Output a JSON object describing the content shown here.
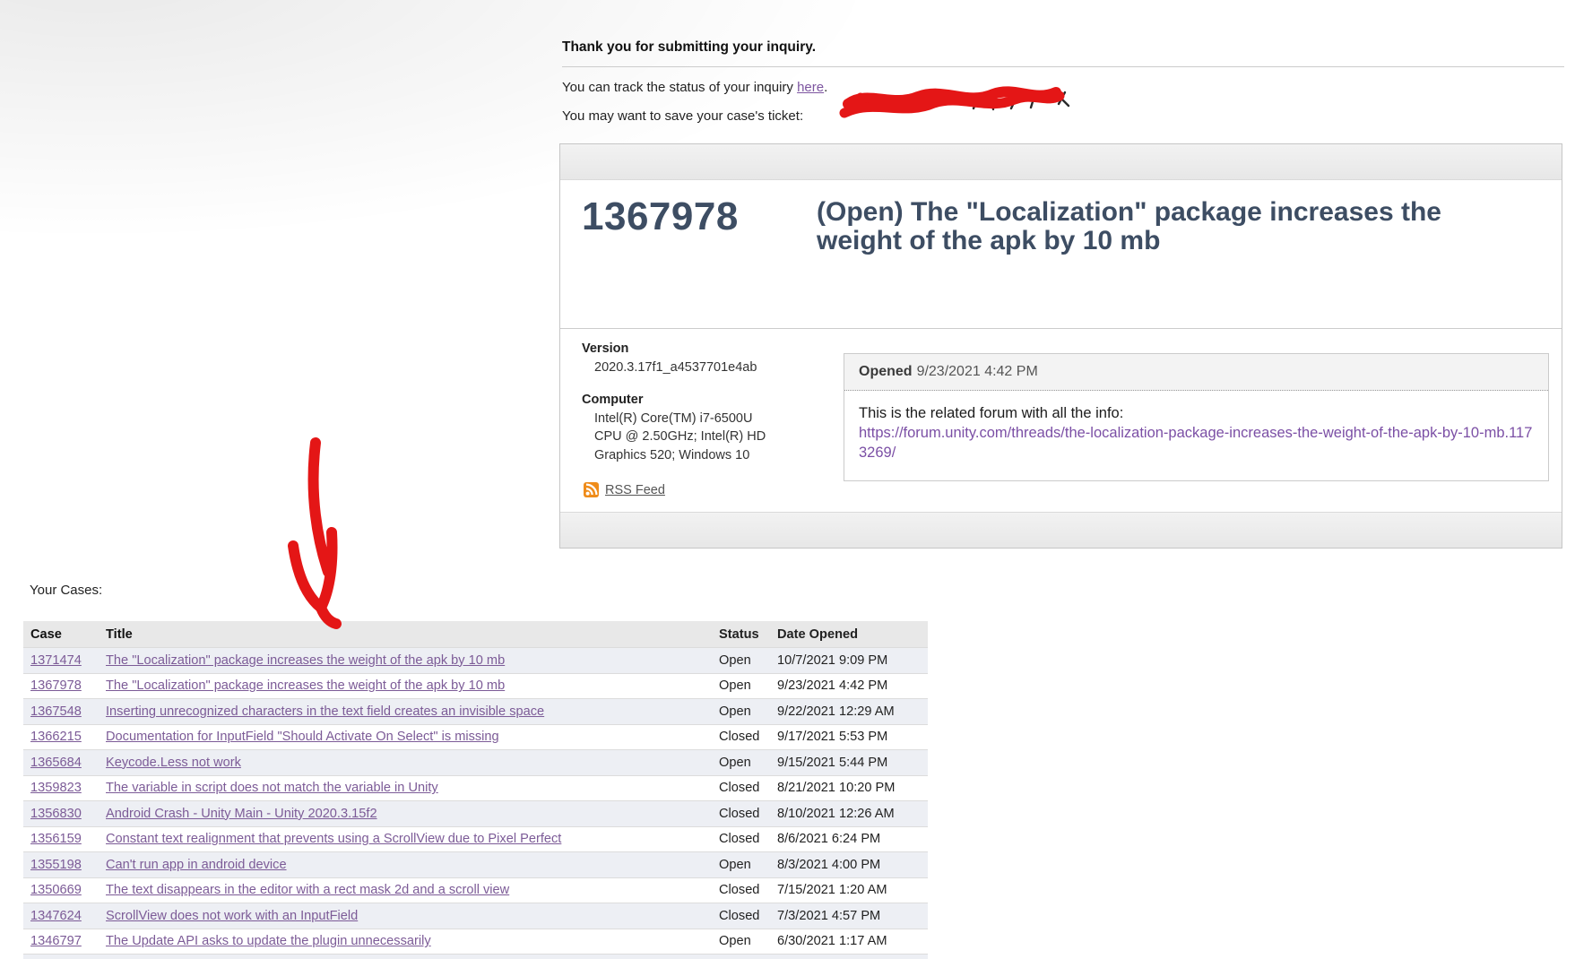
{
  "confirmation": {
    "heading": "Thank you for submitting your inquiry.",
    "track_prefix": "You can track the status of your inquiry ",
    "track_link": "here",
    "track_suffix": ".",
    "ticket_line": "You may want to save your case's ticket:"
  },
  "case_panel": {
    "case_number": "1367978",
    "title": "(Open) The \"Localization\" package increases the weight of the apk by 10 mb",
    "version_label": "Version",
    "version_value": "2020.3.17f1_a4537701e4ab",
    "computer_label": "Computer",
    "computer_value": "Intel(R) Core(TM) i7-6500U CPU @ 2.50GHz; Intel(R) HD Graphics 520; Windows 10",
    "rss_label": "RSS Feed",
    "opened_label": "Opened",
    "opened_datetime": "9/23/2021 4:42 PM",
    "comment_text": "This is the related forum with all the info:",
    "comment_link": "https://forum.unity.com/threads/the-localization-package-increases-the-weight-of-the-apk-by-10-mb.1173269/"
  },
  "your_cases": {
    "label": "Your Cases:",
    "columns": [
      "Case",
      "Title",
      "Status",
      "Date Opened"
    ],
    "rows": [
      {
        "case_number": "1371474",
        "title": "The \"Localization\" package increases the weight of the apk by 10 mb",
        "status": "Open",
        "date_opened": "10/7/2021 9:09 PM"
      },
      {
        "case_number": "1367978",
        "title": "The \"Localization\" package increases the weight of the apk by 10 mb",
        "status": "Open",
        "date_opened": "9/23/2021 4:42 PM"
      },
      {
        "case_number": "1367548",
        "title": "Inserting unrecognized characters in the text field creates an invisible space",
        "status": "Open",
        "date_opened": "9/22/2021 12:29 AM"
      },
      {
        "case_number": "1366215",
        "title": "Documentation for InputField \"Should Activate On Select\" is missing",
        "status": "Closed",
        "date_opened": "9/17/2021 5:53 PM"
      },
      {
        "case_number": "1365684",
        "title": "Keycode.Less not work",
        "status": "Open",
        "date_opened": "9/15/2021 5:44 PM"
      },
      {
        "case_number": "1359823",
        "title": "The variable in script does not match the variable in Unity",
        "status": "Closed",
        "date_opened": "8/21/2021 10:20 PM"
      },
      {
        "case_number": "1356830",
        "title": "Android Crash - Unity Main - Unity 2020.3.15f2",
        "status": "Closed",
        "date_opened": "8/10/2021 12:26 AM"
      },
      {
        "case_number": "1356159",
        "title": "Constant text realignment that prevents using a ScrollView due to Pixel Perfect",
        "status": "Closed",
        "date_opened": "8/6/2021 6:24 PM"
      },
      {
        "case_number": "1355198",
        "title": "Can't run app in android device",
        "status": "Open",
        "date_opened": "8/3/2021 4:00 PM"
      },
      {
        "case_number": "1350669",
        "title": "The text disappears in the editor with a rect mask 2d and a scroll view",
        "status": "Closed",
        "date_opened": "7/15/2021 1:20 AM"
      },
      {
        "case_number": "1347624",
        "title": "ScrollView does not work with an InputField",
        "status": "Closed",
        "date_opened": "7/3/2021 4:57 PM"
      },
      {
        "case_number": "1346797",
        "title": "The Update API asks to update the plugin unnecessarily",
        "status": "Open",
        "date_opened": "6/30/2021 1:17 AM"
      }
    ]
  },
  "icons": {
    "rss": "rss-feed-icon"
  },
  "colors": {
    "case_title_navy": "#3d4d63",
    "link_purple": "#7d55a0",
    "table_link_purple": "#7c5b97",
    "annotation_red": "#e41616",
    "row_alt": "#edeff4",
    "table_header_gray": "#e8e8e8"
  }
}
